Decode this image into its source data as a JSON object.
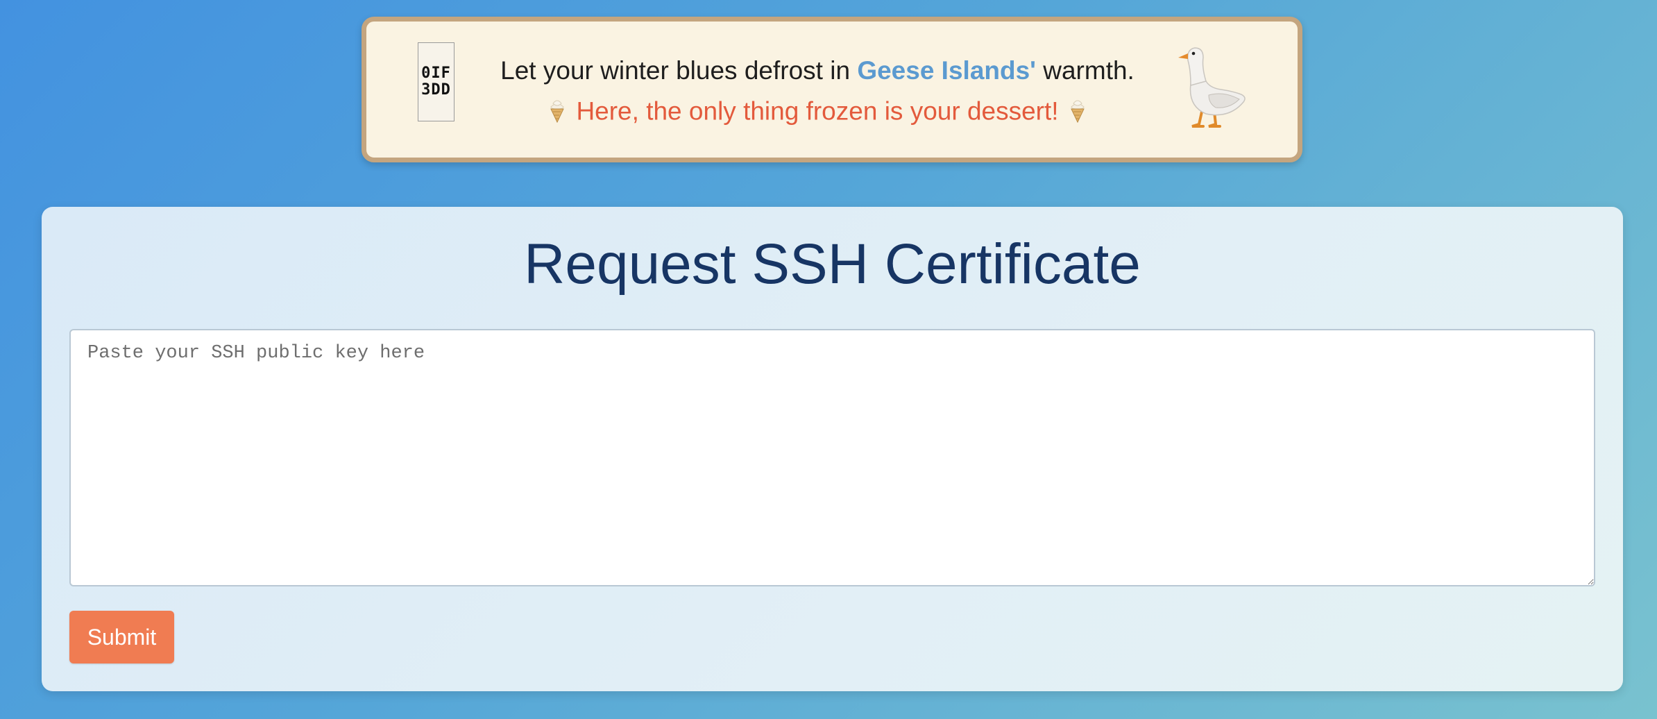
{
  "banner": {
    "glyph_top": "0IF",
    "glyph_bottom": "3DD",
    "line1_before": "Let your winter blues defrost in ",
    "line1_highlight": "Geese Islands'",
    "line1_after": " warmth.",
    "line2_text": "Here, the only thing frozen is your dessert!",
    "left_icon": "ice-cream-cone-icon",
    "right_icon": "ice-cream-cone-icon",
    "mascot_icon": "goose-icon",
    "colors": {
      "background": "#faf3e2",
      "border": "#c4a57f",
      "highlight": "#5b9ad0",
      "line2": "#e35a3c"
    }
  },
  "form": {
    "title": "Request SSH Certificate",
    "key_placeholder": "Paste your SSH public key here",
    "key_value": "",
    "submit_label": "Submit",
    "colors": {
      "title": "#173564",
      "submit_bg": "#f07c52"
    }
  }
}
